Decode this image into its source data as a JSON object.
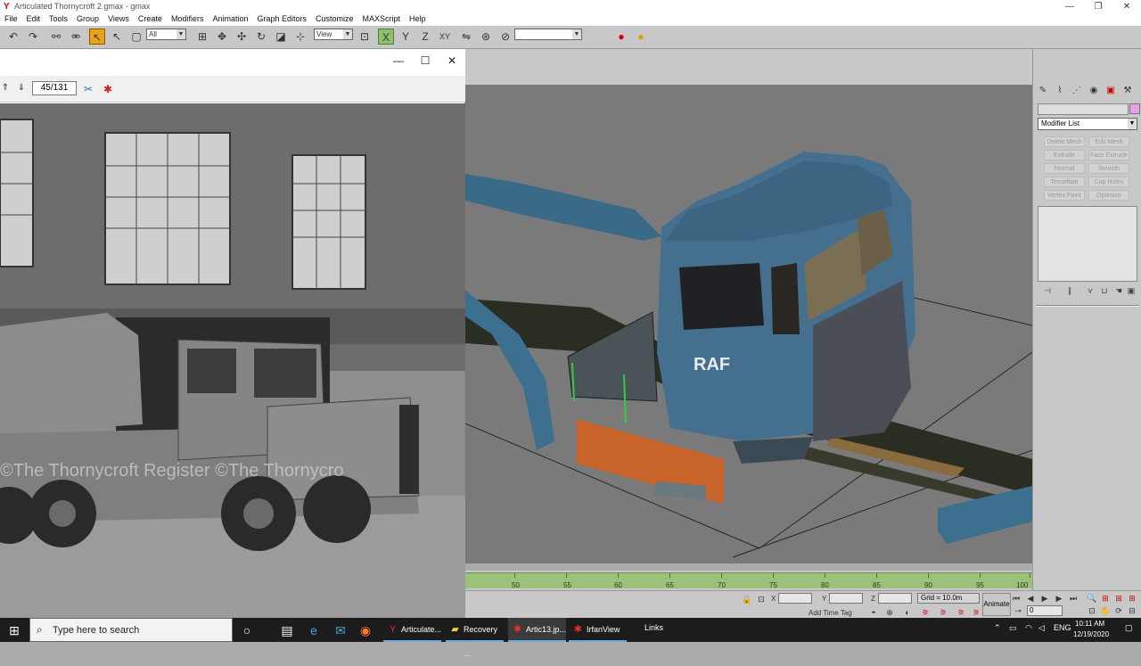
{
  "app_window": {
    "title": "Articulated Thornycroft 2.gmax - gmax",
    "controls": [
      "—",
      "❐",
      "✕"
    ]
  },
  "menu": [
    "File",
    "Edit",
    "Tools",
    "Group",
    "Views",
    "Create",
    "Modifiers",
    "Animation",
    "Graph Editors",
    "Customize",
    "MAXScript",
    "Help"
  ],
  "toolbar": {
    "selection_filter": "All",
    "reference_coord": "View",
    "named_selection": ""
  },
  "viewport": {
    "decal_text": "RAF"
  },
  "command_panel": {
    "modifier_list": "Modifier List",
    "modifier_buttons": [
      "Delete Mesh",
      "Edit Mesh",
      "Extrude",
      "Face Extrude",
      "Normal",
      "Smooth",
      "Tessellate",
      "Cap Holes",
      "Vertex Paint",
      "Optimize"
    ]
  },
  "trackbar": {
    "ticks": [
      "50",
      "55",
      "60",
      "65",
      "70",
      "75",
      "80",
      "85",
      "90",
      "95",
      "100"
    ]
  },
  "statusbar": {
    "x_label": "X",
    "y_label": "Y",
    "z_label": "Z",
    "grid": "Grid = 10.0m",
    "animate": "Animate",
    "add_time_tag": "Add Time Tag",
    "frame_value": "0"
  },
  "irfanview": {
    "page_counter": "45/131",
    "controls": [
      "—",
      "☐",
      "✕"
    ],
    "watermark": "©The Thornycroft Register  ©The Thornycro"
  },
  "taskbar": {
    "search_placeholder": "Type here to search",
    "apps": [
      {
        "label": "Articulate...",
        "icon_color": "#e23030"
      },
      {
        "label": "Recovery ...",
        "icon_color": "#f2c94c"
      },
      {
        "label": "Artic13.jp...",
        "icon_color": "#e23030"
      },
      {
        "label": "IrfanView",
        "icon_color": "#e23030"
      }
    ],
    "links": "Links",
    "lang": "ENG",
    "time": "10:11 AM",
    "date": "12/19/2020"
  }
}
